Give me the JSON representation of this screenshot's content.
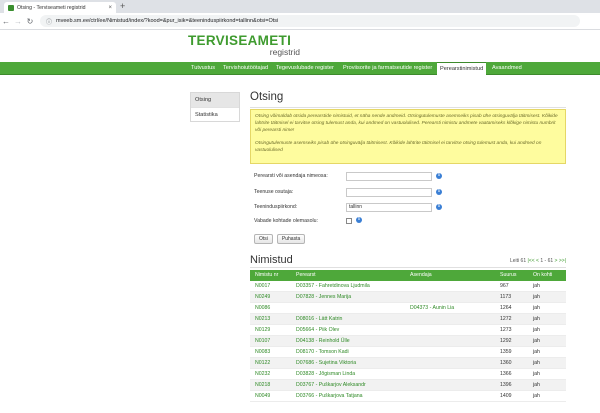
{
  "browser": {
    "tab_title": "Otsing - Terviseameti registrid",
    "tab_close": "×",
    "new_tab": "+",
    "url": "mveeb.sm.ee/ctrl/ee/Nimistud/index/?kood=&pur_isik=&teeninduspiirkond=tallinn&otsi=Otsi"
  },
  "site": {
    "logo_line1": "TERVISEAMETI",
    "logo_line2": "registrid",
    "nav": [
      {
        "label": "Tutvustus"
      },
      {
        "label": "Tervishoiutöötajad"
      },
      {
        "label": "Tegevuslubade register"
      },
      {
        "label": "Proviisorite ja farmatseutide register"
      },
      {
        "label": "Perearstinimistud"
      },
      {
        "label": "Avaandmed"
      }
    ],
    "active_nav": "Perearstinimistud"
  },
  "sidebar": {
    "items": [
      {
        "label": "Otsing"
      },
      {
        "label": "Statistika"
      }
    ]
  },
  "search": {
    "title": "Otsing",
    "notice_p1": "Otsing võimaldab otsida perearstide nimistuid, et näha nende andmeid. Otsingutulemuste asemseiks pisab ühe otsinguvälja täitmisest. Kõikide lahtrite täitmisel ei tarvitse otsing tulemust anda, kui andmed on vastuolulised. Perearsti nimistu andmete vaatamiseks klõkige nimistu numbrit või perearsti nime!",
    "notice_p2": "Otsingutulemuste asemseiks pisab ühe otsinguvälja täitmisest. Kõikide lahtrite täitmisel ei tarvitse otsing tulemust anda, kui andmed on vastuolulised",
    "fields": [
      {
        "label": "Perearsti või asendaja nimeosa:",
        "value": ""
      },
      {
        "label": "Teenuse osutaja:",
        "value": ""
      },
      {
        "label": "Teeninduspiirkond:",
        "value": "tallinn"
      },
      {
        "label": "Vabade kohtade olemasolu:",
        "value": ""
      }
    ],
    "info_icon": "i",
    "btn_search": "Otsi",
    "btn_clear": "Puhasta"
  },
  "results": {
    "title": "Nimistud",
    "pager_prefix": "Leiti 61",
    "pager_first": "|<<",
    "pager_prev": "<",
    "pager_range": "1 - 61",
    "pager_next": ">",
    "pager_last": ">>|",
    "columns": [
      "Nimistu nr",
      "Perearst",
      "Asendaja",
      "Suurus",
      "On kohti"
    ],
    "rows": [
      {
        "nr": "N0017",
        "perearst": "D03357 - Fahretdinova Ljudmila",
        "asendaja": "",
        "suurus": "967",
        "kohti": "jah"
      },
      {
        "nr": "N0249",
        "perearst": "D07828 - Jennes Marija",
        "asendaja": "",
        "suurus": "1173",
        "kohti": "jah"
      },
      {
        "nr": "N0086",
        "perearst": "",
        "asendaja": "D04373 - Aunin Lia",
        "suurus": "1264",
        "kohti": "jah"
      },
      {
        "nr": "N0213",
        "perearst": "D08016 - Lätt Katrin",
        "asendaja": "",
        "suurus": "1272",
        "kohti": "jah"
      },
      {
        "nr": "N0129",
        "perearst": "D05664 - Piik Olev",
        "asendaja": "",
        "suurus": "1273",
        "kohti": "jah"
      },
      {
        "nr": "N0107",
        "perearst": "D04138 - Reinhold Ülle",
        "asendaja": "",
        "suurus": "1292",
        "kohti": "jah"
      },
      {
        "nr": "N0083",
        "perearst": "D08170 - Tomson Kadi",
        "asendaja": "",
        "suurus": "1359",
        "kohti": "jah"
      },
      {
        "nr": "N0122",
        "perearst": "D07686 - Sujetina Viktoria",
        "asendaja": "",
        "suurus": "1360",
        "kohti": "jah"
      },
      {
        "nr": "N0232",
        "perearst": "D03828 - Jõgisman Linda",
        "asendaja": "",
        "suurus": "1366",
        "kohti": "jah"
      },
      {
        "nr": "N0218",
        "perearst": "D03767 - Puškarjov Aleksandr",
        "asendaja": "",
        "suurus": "1396",
        "kohti": "jah"
      },
      {
        "nr": "N0049",
        "perearst": "D03766 - Puškarjova Tatjana",
        "asendaja": "",
        "suurus": "1409",
        "kohti": "jah"
      }
    ]
  }
}
